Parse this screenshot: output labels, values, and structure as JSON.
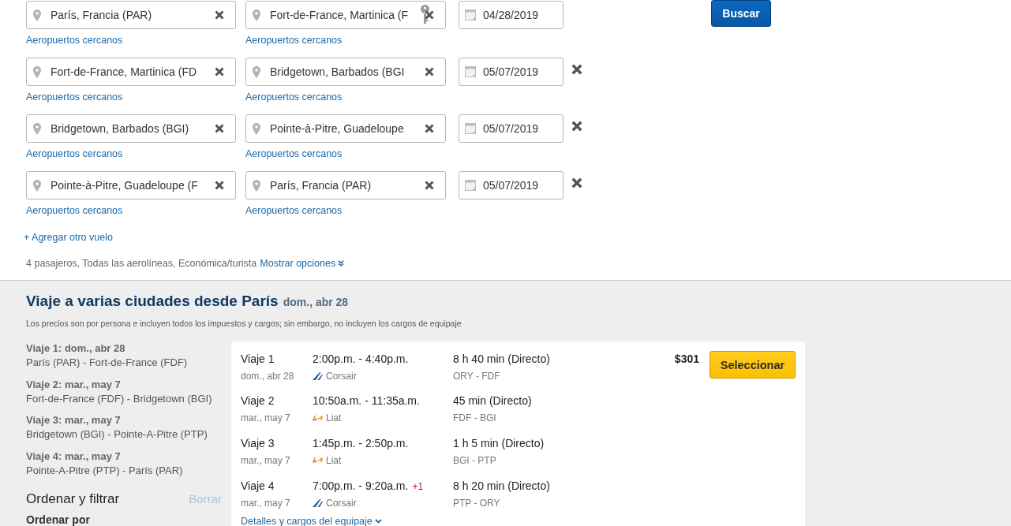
{
  "search_form": {
    "flights": [
      {
        "origin": {
          "value": "París, Francia (PAR)",
          "key_icon": false,
          "nearby_link": "Aeropuertos cercanos"
        },
        "destination": {
          "value": "Fort-de-France, Martinica (F",
          "key_icon": true,
          "nearby_link": "Aeropuertos cercanos"
        },
        "date": "04/28/2019",
        "removable": false
      },
      {
        "origin": {
          "value": "Fort-de-France, Martinica (FD",
          "key_icon": false,
          "nearby_link": "Aeropuertos cercanos"
        },
        "destination": {
          "value": "Bridgetown, Barbados (BGI",
          "key_icon": false,
          "nearby_link": "Aeropuertos cercanos"
        },
        "date": "05/07/2019",
        "removable": true
      },
      {
        "origin": {
          "value": "Bridgetown, Barbados (BGI)",
          "key_icon": false,
          "nearby_link": "Aeropuertos cercanos"
        },
        "destination": {
          "value": "Pointe-à-Pitre, Guadeloupe",
          "key_icon": false,
          "nearby_link": "Aeropuertos cercanos"
        },
        "date": "05/07/2019",
        "removable": true
      },
      {
        "origin": {
          "value": "Pointe-à-Pitre, Guadeloupe (F",
          "key_icon": false,
          "nearby_link": "Aeropuertos cercanos"
        },
        "destination": {
          "value": "París, Francia (PAR)",
          "key_icon": false,
          "nearby_link": "Aeropuertos cercanos"
        },
        "date": "05/07/2019",
        "removable": true
      }
    ],
    "search_button": "Buscar",
    "add_flight_link": "+ Agregar otro vuelo",
    "options_summary": "4 pasajeros, Todas las aerolíneas, Económica/turista",
    "options_link": "Mostrar opciones"
  },
  "results": {
    "title": "Viaje a varias ciudades desde París",
    "title_date": "dom., abr 28",
    "price_note": "Los precios son por persona e incluyen todos los impuestos y cargos; sin embargo, no incluyen los cargos de equipaje",
    "trip_summaries": [
      {
        "heading": "Viaje 1: dom., abr 28",
        "route": "París (PAR) - Fort-de-France (FDF)"
      },
      {
        "heading": "Viaje 2: mar., may 7",
        "route": "Fort-de-France (FDF) - Bridgetown (BGI)"
      },
      {
        "heading": "Viaje 3: mar., may 7",
        "route": "Bridgetown (BGI) - Pointe-A-Pitre (PTP)"
      },
      {
        "heading": "Viaje 4: mar., may 7",
        "route": "Pointe-A-Pitre (PTP) - París (PAR)"
      }
    ],
    "sort_filter": {
      "title": "Ordenar y filtrar",
      "clear_link": "Borrar",
      "clear_disabled": true,
      "sort_label": "Ordenar por"
    },
    "offer": {
      "legs": [
        {
          "label": "Viaje 1",
          "date": "dom., abr 28",
          "times": "2:00p.m. - 4:40p.m.",
          "airline": "Corsair",
          "logo": {
            "kind": "swoosh"
          },
          "duration": "8 h 40 min (Directo)",
          "airports": "ORY - FDF"
        },
        {
          "label": "Viaje 2",
          "date": "mar., may 7",
          "times": "10:50a.m. - 11:35a.m.",
          "airline": "Liat",
          "logo": {
            "kind": "script"
          },
          "duration": "45 min (Directo)",
          "airports": "FDF - BGI"
        },
        {
          "label": "Viaje 3",
          "date": "mar., may 7",
          "times": "1:45p.m. - 2:50p.m.",
          "airline": "Liat",
          "logo": {
            "kind": "script"
          },
          "duration": "1 h 5 min (Directo)",
          "airports": "BGI - PTP"
        },
        {
          "label": "Viaje 4",
          "date": "mar., may 7",
          "times": "7:00p.m. - 9:20a.m.",
          "next_day": "+1",
          "airline": "Corsair",
          "logo": {
            "kind": "swoosh"
          },
          "duration": "8 h 20 min (Directo)",
          "airports": "PTP - ORY"
        }
      ],
      "price": "$301",
      "select_button": "Seleccionar",
      "details_link": "Detalles y cargos del equipaje"
    }
  }
}
